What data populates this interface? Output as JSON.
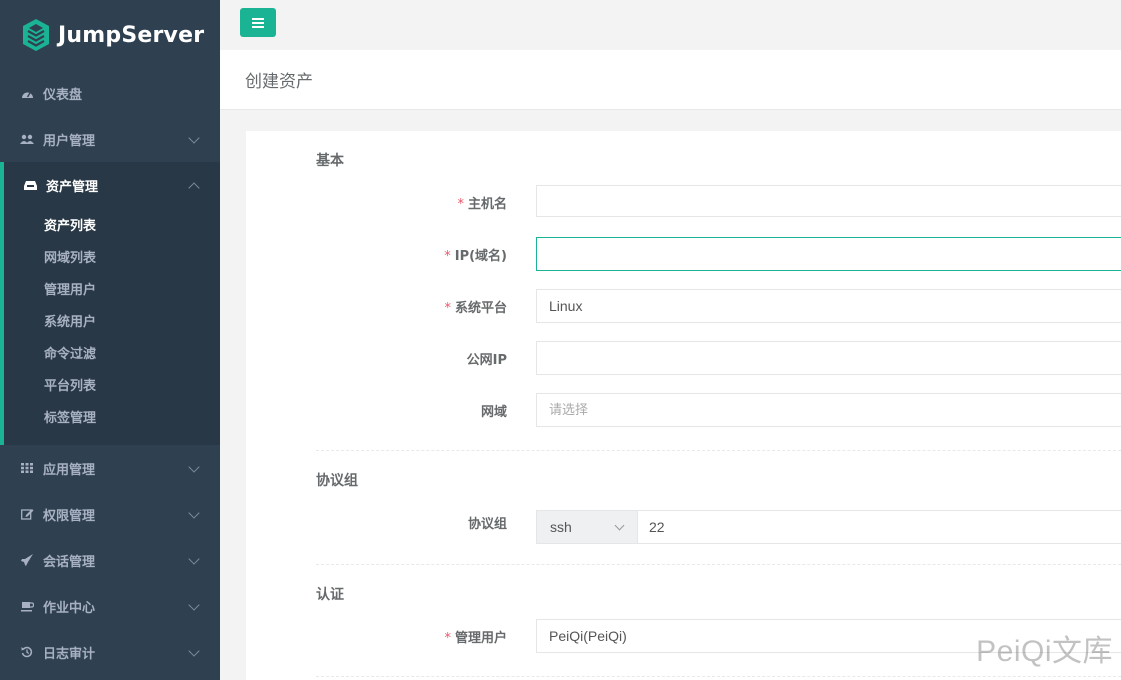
{
  "brand": {
    "name": "JumpServer"
  },
  "sidebar": {
    "items": [
      {
        "label": "仪表盘",
        "icon": "dashboard-icon"
      },
      {
        "label": "用户管理",
        "icon": "users-icon"
      },
      {
        "label": "资产管理",
        "icon": "inbox-icon",
        "active": true,
        "children": [
          "资产列表",
          "网域列表",
          "管理用户",
          "系统用户",
          "命令过滤",
          "平台列表",
          "标签管理"
        ]
      },
      {
        "label": "应用管理",
        "icon": "grid-icon"
      },
      {
        "label": "权限管理",
        "icon": "edit-icon"
      },
      {
        "label": "会话管理",
        "icon": "rocket-icon"
      },
      {
        "label": "作业中心",
        "icon": "coffee-icon"
      },
      {
        "label": "日志审计",
        "icon": "history-icon"
      }
    ],
    "active_child": "资产列表"
  },
  "page": {
    "title": "创建资产"
  },
  "form": {
    "basic_title": "基本",
    "hostname_label": "主机名",
    "hostname_value": "",
    "ip_label": "IP(域名)",
    "ip_value": "",
    "platform_label": "系统平台",
    "platform_value": "Linux",
    "public_ip_label": "公网IP",
    "public_ip_value": "",
    "domain_label": "网域",
    "domain_placeholder": "请选择",
    "protocol_title": "协议组",
    "protocol_label": "协议组",
    "protocol_value": "ssh",
    "port_value": "22",
    "auth_title": "认证",
    "admin_user_label": "管理用户",
    "admin_user_value": "PeiQi(PeiQi)",
    "required_mark": "*"
  },
  "watermark": "PeiQi文库",
  "colors": {
    "accent": "#1ab394",
    "sidebar": "#2f4050",
    "required": "#ed5565"
  }
}
